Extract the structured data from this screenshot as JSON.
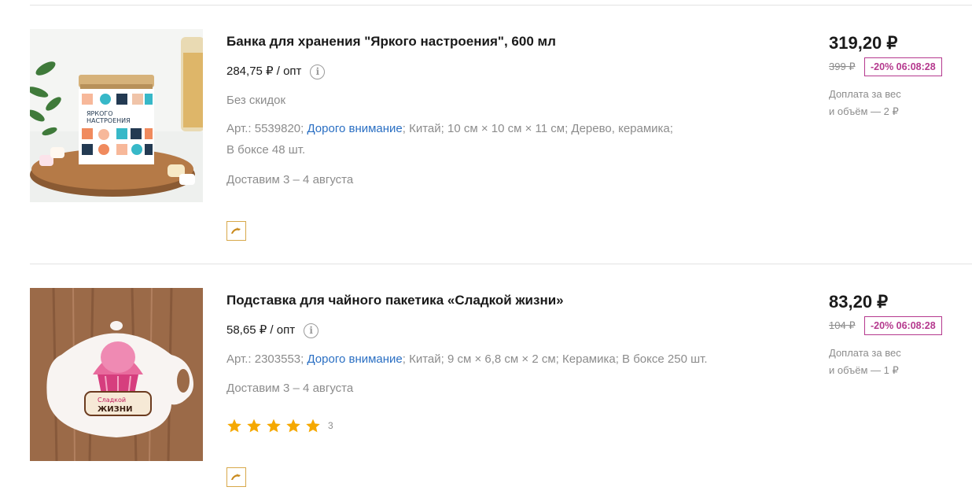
{
  "products": [
    {
      "title": "Банка для хранения \"Яркого настроения\", 600 мл",
      "wholesale_price": "284,75 ₽ / опт",
      "info_glyph": "i",
      "discount_note": "Без скидок",
      "article": "Арт.: 5539820;",
      "brand": "Дорого внимание",
      "country": "Китай;",
      "size": "10 см × 10 см × 11 см;",
      "material": "Дерево, керамика;",
      "box_qty": "В боксе 48 шт.",
      "delivery": "Доставим 3 – 4 августа",
      "price": "319,20 ₽",
      "old_price": "399 ₽",
      "discount_badge": "-20% 06:08:28",
      "extra_fee_line1": "Доплата за вес",
      "extra_fee_line2": "и объём — 2 ₽",
      "compare_icon": "dolphin-icon",
      "image_label_line1": "ЯРКОГО",
      "image_label_line2": "НАСТРОЕНИЯ"
    },
    {
      "title": "Подставка для чайного пакетика «Сладкой жизни»",
      "wholesale_price": "58,65 ₽ / опт",
      "info_glyph": "i",
      "article": "Арт.: 2303553;",
      "brand": "Дорого внимание",
      "country": "Китай;",
      "size": "9 см × 6,8 см × 2 см;",
      "material": "Керамика;",
      "box_qty": "В боксе 250 шт.",
      "delivery": "Доставим 3 – 4 августа",
      "rating": 5,
      "rating_max": 5,
      "reviews_count": "3",
      "price": "83,20 ₽",
      "old_price": "104 ₽",
      "discount_badge": "-20% 06:08:28",
      "extra_fee_line1": "Доплата за вес",
      "extra_fee_line2": "и объём — 1 ₽",
      "compare_icon": "dolphin-icon",
      "image_label_line1": "Сладкой",
      "image_label_line2": "ЖИЗНИ"
    }
  ],
  "colors": {
    "link": "#2a6fc3",
    "discount": "#b5398e",
    "star": "#f5a800",
    "compare_border": "#d7a84a"
  }
}
